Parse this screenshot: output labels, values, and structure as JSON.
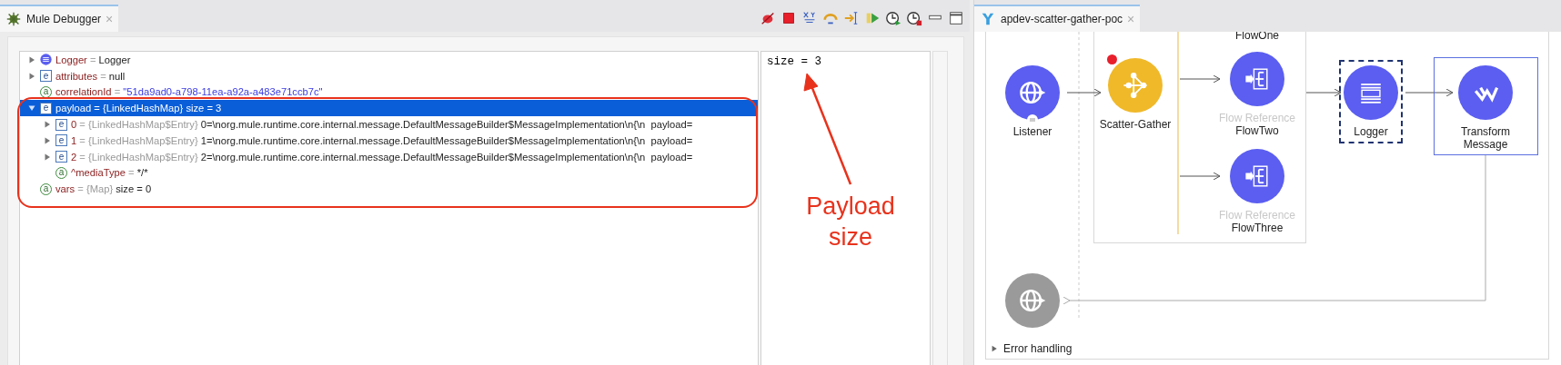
{
  "debugger": {
    "tab": {
      "title": "Mule Debugger",
      "close": "×",
      "selected": true
    },
    "variables": [
      {
        "kind": "processor",
        "name": "Logger",
        "separator": "=",
        "value": "Logger",
        "string_value": false,
        "expanded": false,
        "selected": false
      },
      {
        "kind": "element",
        "badge": "e",
        "name": "attributes",
        "separator": "=",
        "value": "null",
        "string_value": false,
        "expanded": false,
        "selected": false
      },
      {
        "kind": "attribute",
        "badge": "a",
        "name": "correlationId",
        "separator": "=",
        "value": "\"51da9ad0-a798-11ea-a92a-a483e71ccb7c\"",
        "string_value": true,
        "selected": false
      },
      {
        "kind": "element",
        "badge": "e",
        "name": "payload",
        "separator": "=",
        "type": "{LinkedHashMap}",
        "value": "size = 3",
        "string_value": false,
        "expanded": true,
        "selected": true,
        "children": [
          {
            "kind": "element",
            "badge": "e",
            "name": "0",
            "separator": "=",
            "type": "{LinkedHashMap$Entry}",
            "value": "0=\\norg.mule.runtime.core.internal.message.DefaultMessageBuilder$MessageImplementation\\n{\\n  payload=",
            "string_value": false,
            "expanded": false,
            "selected": false
          },
          {
            "kind": "element",
            "badge": "e",
            "name": "1",
            "separator": "=",
            "type": "{LinkedHashMap$Entry}",
            "value": "1=\\norg.mule.runtime.core.internal.message.DefaultMessageBuilder$MessageImplementation\\n{\\n  payload=",
            "string_value": false,
            "expanded": false,
            "selected": false
          },
          {
            "kind": "element",
            "badge": "e",
            "name": "2",
            "separator": "=",
            "type": "{LinkedHashMap$Entry}",
            "value": "2=\\norg.mule.runtime.core.internal.message.DefaultMessageBuilder$MessageImplementation\\n{\\n  payload=",
            "string_value": false,
            "expanded": false,
            "selected": false
          },
          {
            "kind": "attribute",
            "badge": "a",
            "name": "^mediaType",
            "separator": "=",
            "value": "*/*",
            "string_value": false,
            "selected": false
          }
        ]
      },
      {
        "kind": "attribute",
        "badge": "a",
        "name": "vars",
        "separator": "=",
        "type": "{Map}",
        "value": "size = 0",
        "string_value": false,
        "selected": false
      }
    ],
    "detail": "size = 3",
    "annotation": [
      "Payload",
      "size"
    ]
  },
  "flow_editor": {
    "tab": {
      "title": "apdev-scatter-gather-poc",
      "close": "×",
      "selected": true
    },
    "nodes": [
      {
        "kind": "listener",
        "label": "Listener",
        "selected": false,
        "hovered": false,
        "breakpoint": false
      },
      {
        "kind": "scatter_gather",
        "label": "Scatter-Gather",
        "selected": false,
        "hovered": false,
        "breakpoint": true
      },
      {
        "kind": "route_label",
        "label": "FlowOne"
      },
      {
        "kind": "flow_reference",
        "caption": "Flow Reference",
        "label": "FlowTwo",
        "selected": false,
        "hovered": false,
        "breakpoint": false
      },
      {
        "kind": "flow_reference",
        "caption": "Flow Reference",
        "label": "FlowThree",
        "selected": false,
        "hovered": false,
        "breakpoint": false
      },
      {
        "kind": "logger",
        "label": "Logger",
        "selected": true,
        "hovered": false,
        "breakpoint": false
      },
      {
        "kind": "transform",
        "label": "Transform\nMessage",
        "selected": false,
        "hovered": true,
        "breakpoint": false
      },
      {
        "kind": "response",
        "selected": false,
        "hovered": false,
        "breakpoint": false
      }
    ],
    "error_handling": {
      "label": "Error handling",
      "expanded": false
    }
  }
}
